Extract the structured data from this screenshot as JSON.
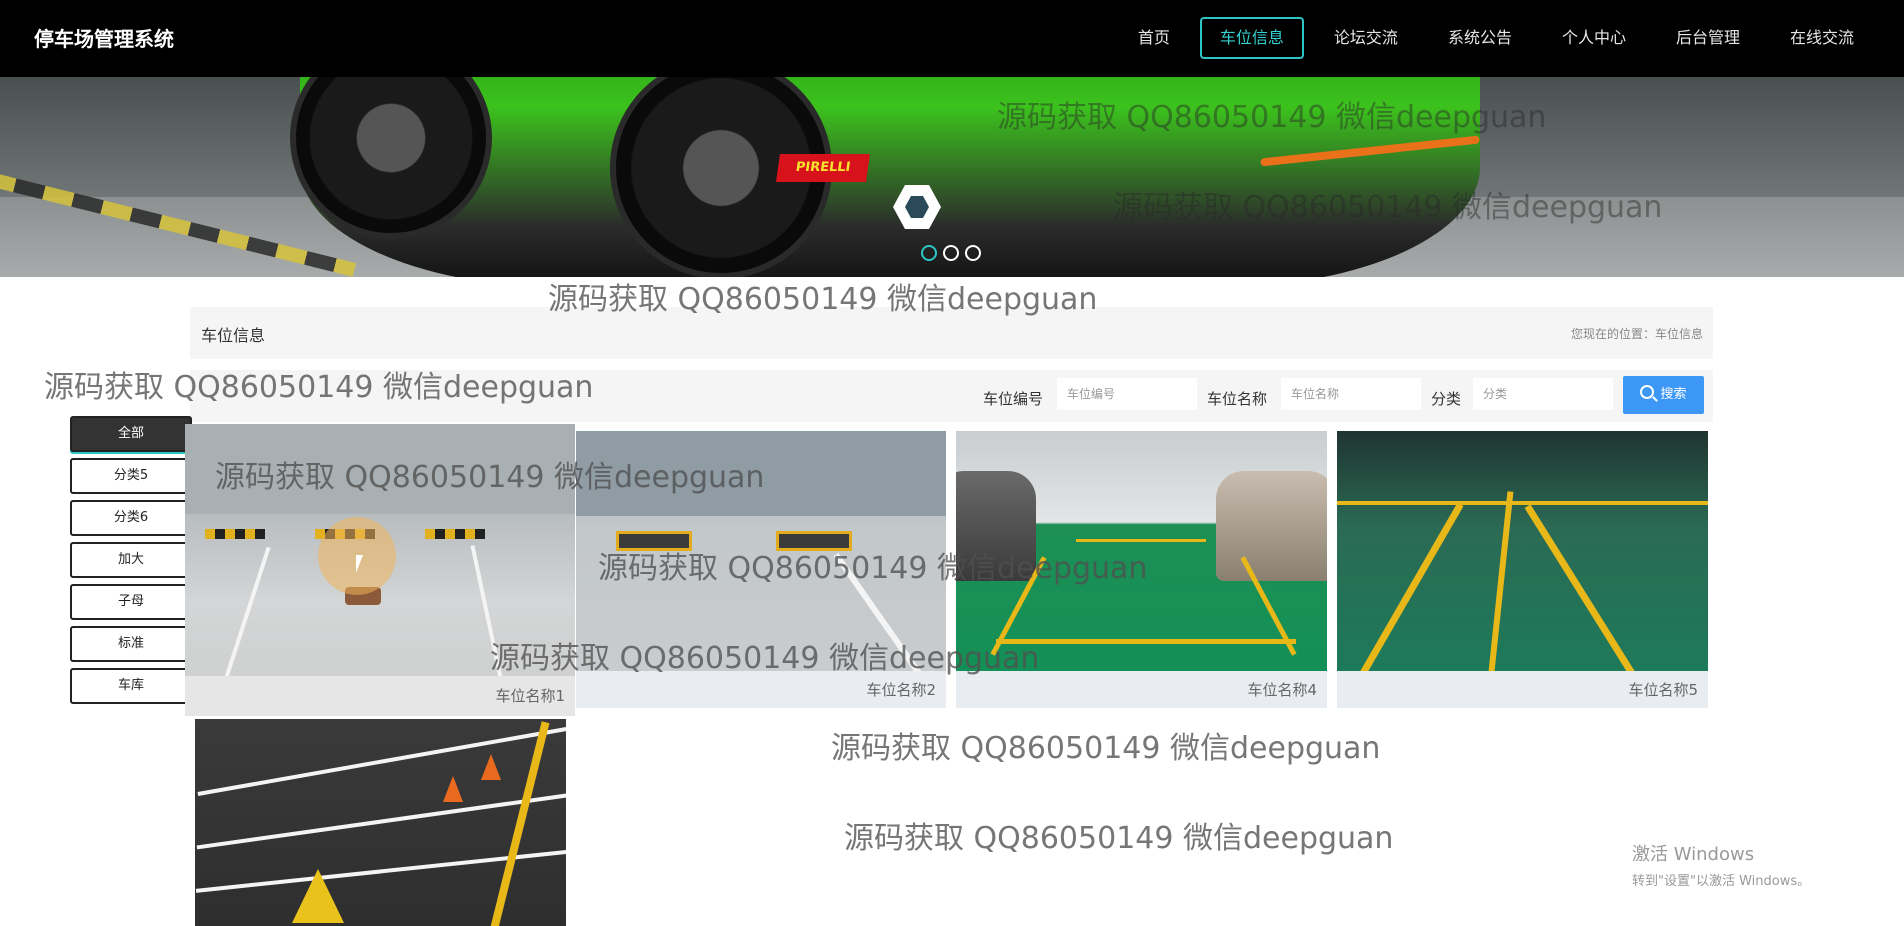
{
  "brand": "停车场管理系统",
  "nav": {
    "items": [
      "首页",
      "车位信息",
      "论坛交流",
      "系统公告",
      "个人中心",
      "后台管理",
      "在线交流"
    ],
    "active_index": 1
  },
  "banner": {
    "sponsor_text": "PIRELLI",
    "slides": 3,
    "active_slide": 1
  },
  "section": {
    "title": "车位信息",
    "breadcrumb": "您现在的位置：车位信息"
  },
  "search": {
    "fields": [
      {
        "label": "车位编号",
        "placeholder": "车位编号"
      },
      {
        "label": "车位名称",
        "placeholder": "车位名称"
      },
      {
        "label": "分类",
        "placeholder": "分类"
      }
    ],
    "button_label": "搜索"
  },
  "categories": [
    "全部",
    "分类5",
    "分类6",
    "加大",
    "子母",
    "标准",
    "车库"
  ],
  "cards": [
    {
      "name": "车位名称1"
    },
    {
      "name": "车位名称2"
    },
    {
      "name": "车位名称4"
    },
    {
      "name": "车位名称5"
    },
    {
      "name": ""
    }
  ],
  "watermark": "源码获取 QQ86050149 微信deepguan",
  "windows": {
    "line1": "激活 Windows",
    "line2": "转到\"设置\"以激活 Windows。"
  },
  "colors": {
    "nav_bg": "#000000",
    "accent": "#2ec4c4",
    "search_button": "#3c97f5",
    "panel_bg": "#f5f5f5"
  }
}
